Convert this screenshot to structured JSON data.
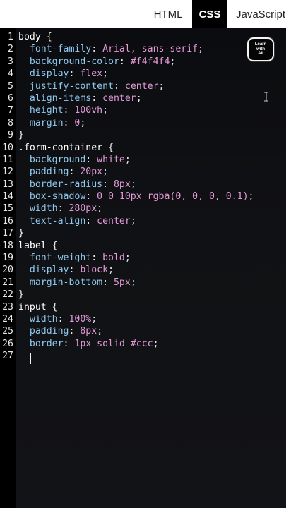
{
  "tabs": [
    {
      "label": "HTML",
      "active": false
    },
    {
      "label": "CSS",
      "active": true
    },
    {
      "label": "JavaScript",
      "active": false
    }
  ],
  "logo": {
    "line1": "Learn",
    "line2": "with",
    "line3": "Ali"
  },
  "editor": {
    "lines": [
      {
        "n": "1",
        "sel": "body",
        "rest": " {"
      },
      {
        "n": "2",
        "prop": "  font-family",
        "val": " Arial, sans-serif",
        "end": ";"
      },
      {
        "n": "3",
        "prop": "  background-color",
        "val": " #f4f4f4",
        "end": ";"
      },
      {
        "n": "4",
        "prop": "  display",
        "val": " flex",
        "end": ";"
      },
      {
        "n": "5",
        "prop": "  justify-content",
        "val": " center",
        "end": ";"
      },
      {
        "n": "6",
        "prop": "  align-items",
        "val": " center",
        "end": ";"
      },
      {
        "n": "7",
        "prop": "  height",
        "val": " 100vh",
        "end": ";"
      },
      {
        "n": "8",
        "prop": "  margin",
        "val": " 0",
        "end": ";"
      },
      {
        "n": "9",
        "sel": "}",
        "rest": ""
      },
      {
        "n": "10",
        "sel": ".form-container",
        "rest": " {"
      },
      {
        "n": "11",
        "prop": "  background",
        "val": " white",
        "end": ";"
      },
      {
        "n": "12",
        "prop": "  padding",
        "val": " 20px",
        "end": ";"
      },
      {
        "n": "13",
        "prop": "  border-radius",
        "val": " 8px",
        "end": ";"
      },
      {
        "n": "14",
        "prop": "  box-shadow",
        "val": " 0 0 10px rgba(0, 0, 0, 0.1)",
        "end": ";"
      },
      {
        "n": "15",
        "prop": "  width",
        "val": " 280px",
        "end": ";"
      },
      {
        "n": "16",
        "prop": "  text-align",
        "val": " center",
        "end": ";"
      },
      {
        "n": "17",
        "sel": "}",
        "rest": ""
      },
      {
        "n": "18",
        "sel": "label",
        "rest": " {"
      },
      {
        "n": "19",
        "prop": "  font-weight",
        "val": " bold",
        "end": ";"
      },
      {
        "n": "20",
        "prop": "  display",
        "val": " block",
        "end": ";"
      },
      {
        "n": "21",
        "prop": "  margin-bottom",
        "val": " 5px",
        "end": ";"
      },
      {
        "n": "22",
        "sel": "}",
        "rest": ""
      },
      {
        "n": "23",
        "sel": "input",
        "rest": " {"
      },
      {
        "n": "24",
        "prop": "  width",
        "val": " 100%",
        "end": ";"
      },
      {
        "n": "25",
        "prop": "  padding",
        "val": " 8px",
        "end": ";"
      },
      {
        "n": "26",
        "prop": "  border",
        "val": " 1px solid #ccc",
        "end": ";"
      },
      {
        "n": "27",
        "sel": "",
        "rest": ""
      }
    ]
  }
}
